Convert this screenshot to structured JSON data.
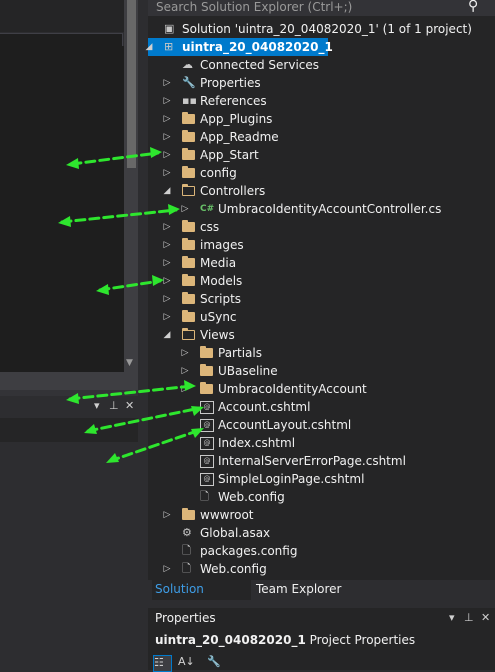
{
  "search": {
    "placeholder": "Search Solution Explorer (Ctrl+;)"
  },
  "tree": {
    "solution": "Solution 'uintra_20_04082020_1' (1 of 1 project)",
    "project": "uintra_20_04082020_1",
    "items": [
      {
        "label": "Connected Services",
        "icon": "cloud-icon",
        "arrow": "",
        "depth": 1
      },
      {
        "label": "Properties",
        "icon": "wrench-icon",
        "arrow": "collapsed",
        "depth": 1
      },
      {
        "label": "References",
        "icon": "references-icon",
        "arrow": "collapsed",
        "depth": 1
      },
      {
        "label": "App_Plugins",
        "icon": "folder-icon",
        "arrow": "collapsed",
        "depth": 1
      },
      {
        "label": "App_Readme",
        "icon": "folder-icon",
        "arrow": "collapsed",
        "depth": 1
      },
      {
        "label": "App_Start",
        "icon": "folder-icon",
        "arrow": "collapsed",
        "depth": 1
      },
      {
        "label": "config",
        "icon": "folder-icon",
        "arrow": "collapsed",
        "depth": 1
      },
      {
        "label": "Controllers",
        "icon": "folder-open-icon",
        "arrow": "expanded",
        "depth": 1
      },
      {
        "label": "UmbracoIdentityAccountController.cs",
        "icon": "csharp-file-icon",
        "arrow": "collapsed",
        "depth": 2
      },
      {
        "label": "css",
        "icon": "folder-icon",
        "arrow": "collapsed",
        "depth": 1
      },
      {
        "label": "images",
        "icon": "folder-icon",
        "arrow": "collapsed",
        "depth": 1
      },
      {
        "label": "Media",
        "icon": "folder-icon",
        "arrow": "collapsed",
        "depth": 1
      },
      {
        "label": "Models",
        "icon": "folder-icon",
        "arrow": "collapsed",
        "depth": 1
      },
      {
        "label": "Scripts",
        "icon": "folder-icon",
        "arrow": "collapsed",
        "depth": 1
      },
      {
        "label": "uSync",
        "icon": "folder-icon",
        "arrow": "collapsed",
        "depth": 1
      },
      {
        "label": "Views",
        "icon": "folder-open-icon",
        "arrow": "expanded",
        "depth": 1
      },
      {
        "label": "Partials",
        "icon": "folder-icon",
        "arrow": "collapsed",
        "depth": 2
      },
      {
        "label": "UBaseline",
        "icon": "folder-icon",
        "arrow": "collapsed",
        "depth": 2
      },
      {
        "label": "UmbracoIdentityAccount",
        "icon": "folder-icon",
        "arrow": "collapsed",
        "depth": 2
      },
      {
        "label": "Account.cshtml",
        "icon": "cshtml-file-icon",
        "arrow": "",
        "depth": 2
      },
      {
        "label": "AccountLayout.cshtml",
        "icon": "cshtml-file-icon",
        "arrow": "",
        "depth": 2
      },
      {
        "label": "Index.cshtml",
        "icon": "cshtml-file-icon",
        "arrow": "",
        "depth": 2
      },
      {
        "label": "InternalServerErrorPage.cshtml",
        "icon": "cshtml-file-icon",
        "arrow": "",
        "depth": 2
      },
      {
        "label": "SimpleLoginPage.cshtml",
        "icon": "cshtml-file-icon",
        "arrow": "",
        "depth": 2
      },
      {
        "label": "Web.config",
        "icon": "config-file-icon",
        "arrow": "",
        "depth": 2
      },
      {
        "label": "wwwroot",
        "icon": "folder-icon",
        "arrow": "collapsed",
        "depth": 1
      },
      {
        "label": "Global.asax",
        "icon": "asax-file-icon",
        "arrow": "",
        "depth": 1
      },
      {
        "label": "packages.config",
        "icon": "config-file-icon",
        "arrow": "",
        "depth": 1
      },
      {
        "label": "Web.config",
        "icon": "config-file-icon",
        "arrow": "collapsed",
        "depth": 1
      }
    ]
  },
  "tabs": {
    "solution_explorer": "Solution Explorer",
    "team_explorer": "Team Explorer"
  },
  "properties": {
    "title": "Properties",
    "object_name": "uintra_20_04082020_1",
    "object_type": "Project Properties"
  },
  "colors": {
    "accent": "#007acc",
    "annotation_arrow": "#2ee62e",
    "folder": "#dcb67a"
  }
}
